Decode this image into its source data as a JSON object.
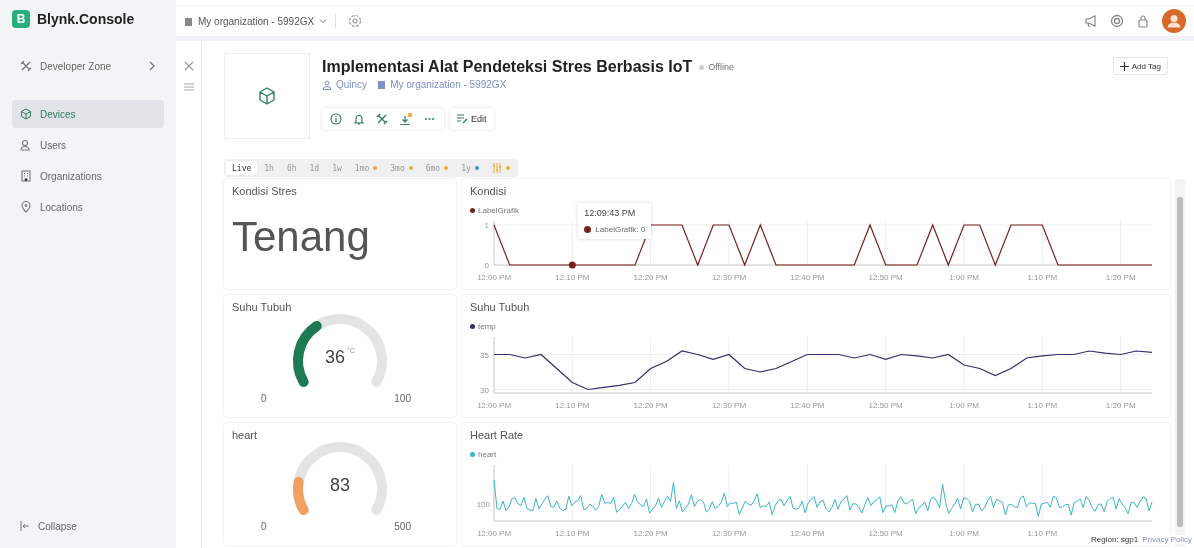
{
  "app": {
    "logo_letter": "B",
    "name": "Blynk.Console"
  },
  "sidebar": {
    "developer_zone": "Developer Zone",
    "items": [
      {
        "label": "Devices",
        "selected": true
      },
      {
        "label": "Users",
        "selected": false
      },
      {
        "label": "Organizations",
        "selected": false
      },
      {
        "label": "Locations",
        "selected": false
      }
    ],
    "collapse": "Collapse"
  },
  "topbar": {
    "organization": "My organization - 5992GX"
  },
  "device": {
    "name": "Implementasi Alat Pendeteksi Stres Berbasis IoT",
    "status": "Offline",
    "online": false,
    "owner": "Quincy",
    "organization": "My organization - 5992GX",
    "edit": "Edit",
    "add_tag": "Add Tag"
  },
  "time_ranges": [
    {
      "kind": "range",
      "label": "Live",
      "selected": true
    },
    {
      "kind": "range",
      "label": "1h",
      "selected": false
    },
    {
      "kind": "range",
      "label": "6h",
      "selected": false
    },
    {
      "kind": "range",
      "label": "1d",
      "selected": false
    },
    {
      "kind": "range",
      "label": "1w",
      "selected": false
    },
    {
      "kind": "range",
      "label": "1mo",
      "selected": false,
      "color": "#f0a830"
    },
    {
      "kind": "range",
      "label": "3mo",
      "selected": false,
      "color": "#f0a830"
    },
    {
      "kind": "range",
      "label": "6mo",
      "selected": false,
      "color": "#f0a830"
    },
    {
      "kind": "range",
      "label": "1y",
      "selected": false,
      "color": "#3a8fd8"
    },
    {
      "kind": "filter",
      "selected": false,
      "color": "#f0a830"
    }
  ],
  "widgets": [
    {
      "kind": "label",
      "title": "Kondisi Stres",
      "value": "Tenang"
    },
    {
      "kind": "chart",
      "title": "Kondisi",
      "tooltip": {
        "time": "12:09:43 PM",
        "text": "LabelGrafik: 0"
      },
      "chart_data": {
        "type": "line",
        "grid": true,
        "ylim": [
          0,
          1.1
        ],
        "categories": [
          "12:00 PM",
          null,
          null,
          null,
          null,
          "12:10 PM",
          null,
          null,
          null,
          null,
          "12:20 PM",
          null,
          null,
          null,
          null,
          "12:30 PM",
          null,
          null,
          null,
          null,
          "12:40 PM",
          null,
          null,
          null,
          null,
          "12:50 PM",
          null,
          null,
          null,
          null,
          "1:00 PM",
          null,
          null,
          null,
          null,
          "1:10 PM",
          null,
          null,
          null,
          null,
          "1:20 PM",
          null,
          null
        ],
        "series": [
          {
            "name": "LabelGrafik",
            "color": "#7a1e1e",
            "values": [
              1,
              0,
              0,
              0,
              0,
              0,
              0,
              0,
              0,
              0,
              1,
              1,
              1,
              0,
              1,
              1,
              0,
              1,
              0,
              0,
              0,
              0,
              0,
              0,
              1,
              0,
              0,
              0,
              1,
              0,
              1,
              1,
              0,
              1,
              1,
              1,
              0,
              0,
              0,
              0,
              0,
              0,
              0
            ]
          }
        ],
        "yticks": [
          0,
          1
        ]
      }
    },
    {
      "kind": "gauge",
      "title": "Suhu Tubuh",
      "value": "36",
      "unit": "°C",
      "min": "0",
      "max": "100",
      "color": "#1e7a55"
    },
    {
      "kind": "chart",
      "title": "Suhu Tubuh",
      "chart_data": {
        "type": "line",
        "grid": true,
        "ylim": [
          29.5,
          37.5
        ],
        "categories": [
          "12:00 PM",
          null,
          null,
          null,
          null,
          "12:10 PM",
          null,
          null,
          null,
          null,
          "12:20 PM",
          null,
          null,
          null,
          null,
          "12:30 PM",
          null,
          null,
          null,
          null,
          "12:40 PM",
          null,
          null,
          null,
          null,
          "12:50 PM",
          null,
          null,
          null,
          null,
          "1:00 PM",
          null,
          null,
          null,
          null,
          "1:10 PM",
          null,
          null,
          null,
          null,
          "1:20 PM",
          null,
          null
        ],
        "series": [
          {
            "name": "temp",
            "color": "#3a2a6e",
            "values": [
              35,
              35,
              34.5,
              35,
              33,
              31,
              30,
              30.3,
              30.6,
              31,
              33,
              34,
              35.5,
              35,
              34.3,
              35,
              33,
              32.5,
              33,
              34,
              35,
              35,
              35,
              34.5,
              35,
              34.3,
              35,
              34.8,
              34.5,
              35,
              33.5,
              33,
              32,
              33,
              34.5,
              34.8,
              35,
              35,
              35.5,
              35.2,
              35,
              35.5,
              35.3
            ]
          }
        ],
        "yticks": [
          30,
          35
        ]
      }
    },
    {
      "kind": "gauge",
      "title": "heart",
      "value": "83",
      "min": "0",
      "max": "500",
      "color": "#f0a060"
    },
    {
      "kind": "trace",
      "title": "Heart Rate",
      "legend": {
        "name": "heart",
        "color": "#3ab4cc"
      },
      "y_label": "100",
      "x_labels": [
        "12:00 PM",
        "12:10 PM",
        "12:20 PM",
        "12:30 PM",
        "12:40 PM",
        "12:50 PM",
        "1:00 PM",
        "1:10 PM"
      ]
    }
  ],
  "footer": {
    "region": "Region: sgp1",
    "privacy": "Privacy Policy"
  }
}
